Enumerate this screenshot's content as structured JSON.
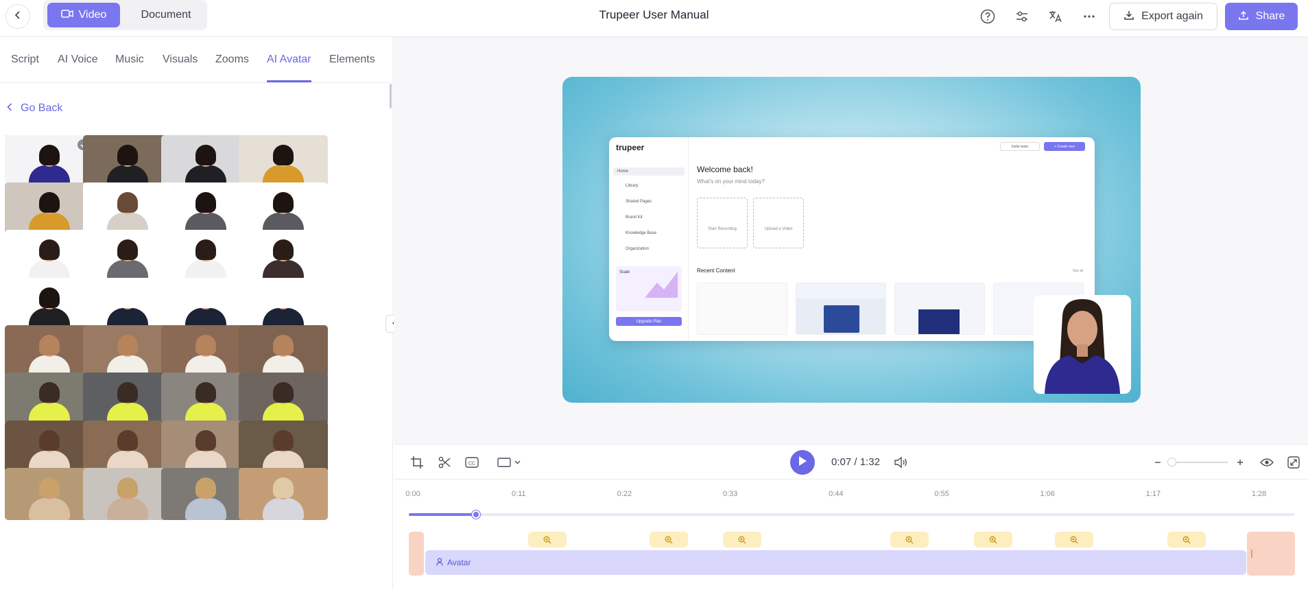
{
  "header": {
    "title": "Trupeer User Manual",
    "mode_video": "Video",
    "mode_document": "Document",
    "export_label": "Export again",
    "share_label": "Share",
    "accent": "#7a76ee"
  },
  "left_panel": {
    "tabs": [
      {
        "label": "Script",
        "active": false
      },
      {
        "label": "AI Voice",
        "active": false
      },
      {
        "label": "Music",
        "active": false
      },
      {
        "label": "Visuals",
        "active": false
      },
      {
        "label": "Zooms",
        "active": false
      },
      {
        "label": "AI Avatar",
        "active": true
      },
      {
        "label": "Elements",
        "active": false
      }
    ],
    "go_back": "Go Back",
    "avatar_count": 32,
    "selected_index": 0
  },
  "preview": {
    "app_logo": "trupeer",
    "invite_label": "Invite team",
    "create_label": "+ Create new",
    "welcome": "Welcome back!",
    "welcome_sub": "What's on your mind today?",
    "card_record": "Start Recording",
    "card_upload": "Upload a Video",
    "recent": "Recent Content",
    "see_all": "See all",
    "nav": [
      "Home",
      "Library",
      "Shared Pages",
      "Brand Kit",
      "Knowledge Base",
      "Organization"
    ],
    "promo_title": "Scale",
    "upgrade": "Upgrade Plan"
  },
  "controls": {
    "current_time": "0:07",
    "separator": "/",
    "total_time": "1:32"
  },
  "timeline": {
    "ticks": [
      "0:00",
      "0:11",
      "0:22",
      "0:33",
      "0:44",
      "0:55",
      "1:06",
      "1:17",
      "1:28"
    ],
    "progress_seconds": 7,
    "duration_seconds": 92,
    "avatar_track_label": "Avatar"
  }
}
